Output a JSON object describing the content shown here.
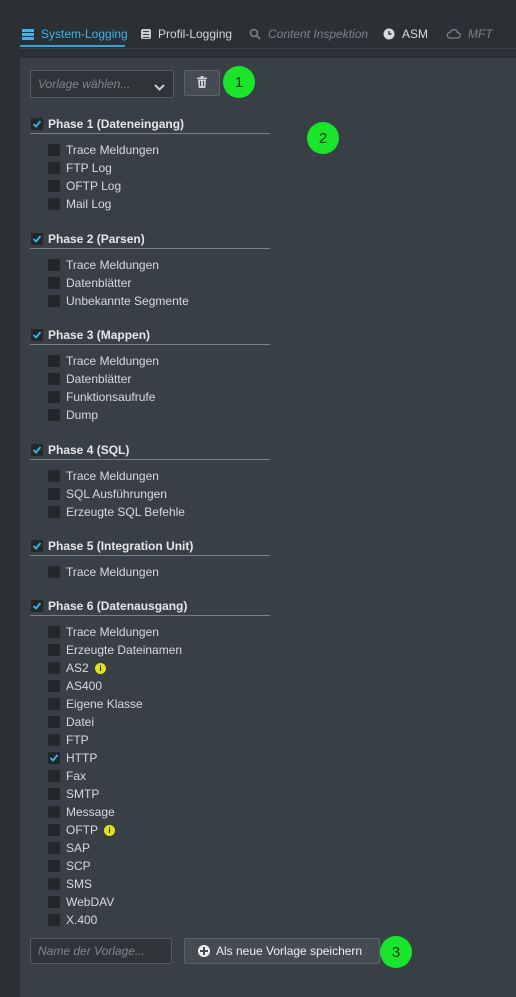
{
  "tabs": [
    {
      "label": "System-Logging",
      "icon": "list-icon",
      "state": "active"
    },
    {
      "label": "Profil-Logging",
      "icon": "cylinder-icon",
      "state": "normal"
    },
    {
      "label": "Content Inspektion",
      "icon": "search-icon",
      "state": "disabled"
    },
    {
      "label": "ASM",
      "icon": "clock-icon",
      "state": "normal"
    },
    {
      "label": "MFT",
      "icon": "cloud-icon",
      "state": "disabled"
    }
  ],
  "template_select": {
    "placeholder": "Vorlage wählen..."
  },
  "markers": {
    "m1": "1",
    "m2": "2",
    "m3": "3"
  },
  "groups": [
    {
      "label": "Phase 1 (Dateneingang)",
      "checked": true,
      "items": [
        {
          "label": "Trace Meldungen",
          "checked": false
        },
        {
          "label": "FTP Log",
          "checked": false
        },
        {
          "label": "OFTP Log",
          "checked": false
        },
        {
          "label": "Mail Log",
          "checked": false
        }
      ]
    },
    {
      "label": "Phase 2 (Parsen)",
      "checked": true,
      "items": [
        {
          "label": "Trace Meldungen",
          "checked": false
        },
        {
          "label": "Datenblätter",
          "checked": false
        },
        {
          "label": "Unbekannte Segmente",
          "checked": false
        }
      ]
    },
    {
      "label": "Phase 3 (Mappen)",
      "checked": true,
      "items": [
        {
          "label": "Trace Meldungen",
          "checked": false
        },
        {
          "label": "Datenblätter",
          "checked": false
        },
        {
          "label": "Funktionsaufrufe",
          "checked": false
        },
        {
          "label": "Dump",
          "checked": false
        }
      ]
    },
    {
      "label": "Phase 4 (SQL)",
      "checked": true,
      "items": [
        {
          "label": "Trace Meldungen",
          "checked": false
        },
        {
          "label": "SQL Ausführungen",
          "checked": false
        },
        {
          "label": "Erzeugte SQL Befehle",
          "checked": false
        }
      ]
    },
    {
      "label": "Phase 5 (Integration Unit)",
      "checked": true,
      "items": [
        {
          "label": "Trace Meldungen",
          "checked": false
        }
      ]
    },
    {
      "label": "Phase 6 (Datenausgang)",
      "checked": true,
      "items": [
        {
          "label": "Trace Meldungen",
          "checked": false
        },
        {
          "label": "Erzeugte Dateinamen",
          "checked": false
        },
        {
          "label": "AS2",
          "checked": false,
          "info": true
        },
        {
          "label": "AS400",
          "checked": false
        },
        {
          "label": "Eigene Klasse",
          "checked": false
        },
        {
          "label": "Datei",
          "checked": false
        },
        {
          "label": "FTP",
          "checked": false
        },
        {
          "label": "HTTP",
          "checked": true
        },
        {
          "label": "Fax",
          "checked": false
        },
        {
          "label": "SMTP",
          "checked": false
        },
        {
          "label": "Message",
          "checked": false
        },
        {
          "label": "OFTP",
          "checked": false,
          "info": true
        },
        {
          "label": "SAP",
          "checked": false
        },
        {
          "label": "SCP",
          "checked": false
        },
        {
          "label": "SMS",
          "checked": false
        },
        {
          "label": "WebDAV",
          "checked": false
        },
        {
          "label": "X.400",
          "checked": false
        }
      ]
    }
  ],
  "footer": {
    "name_placeholder": "Name der Vorlage...",
    "save_label": "Als neue Vorlage speichern"
  },
  "colors": {
    "accent": "#2fa3e6",
    "marker": "#19e62a",
    "info": "#e3e11b"
  }
}
